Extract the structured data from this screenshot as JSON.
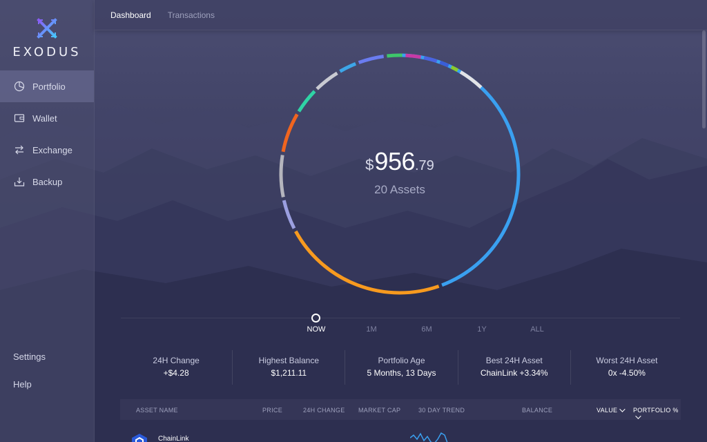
{
  "app": {
    "logo_text": "EXODUS",
    "brand_colors": {
      "primary": "#6b3cf0",
      "secondary": "#4aa7ff"
    }
  },
  "sidebar": {
    "items": [
      {
        "label": "Portfolio",
        "icon": "pie-chart-icon",
        "active": true
      },
      {
        "label": "Wallet",
        "icon": "wallet-icon",
        "active": false
      },
      {
        "label": "Exchange",
        "icon": "exchange-arrows-icon",
        "active": false
      },
      {
        "label": "Backup",
        "icon": "backup-tray-icon",
        "active": false
      }
    ],
    "bottom_links": [
      {
        "label": "Settings"
      },
      {
        "label": "Help"
      }
    ]
  },
  "tabs": [
    {
      "label": "Dashboard",
      "active": true
    },
    {
      "label": "Transactions",
      "active": false
    }
  ],
  "portfolio": {
    "currency_symbol": "$",
    "balance_int": "956",
    "balance_dec": ".79",
    "assets_label": "20 Assets",
    "allocation_colors": [
      "#3aa0f0",
      "#f79a1f",
      "#9b9fe0",
      "#b5b5bd",
      "#f0651f",
      "#2fd3a5",
      "#c9cad2",
      "#3da6e8",
      "#6a7cf0",
      "#3ec66b",
      "#c73aa6",
      "#4a64e0",
      "#3a5ed8",
      "#8acb2a",
      "#e3e3e6"
    ]
  },
  "timeline": {
    "periods": [
      {
        "label": "NOW",
        "active": true
      },
      {
        "label": "1M",
        "active": false
      },
      {
        "label": "6M",
        "active": false
      },
      {
        "label": "1Y",
        "active": false
      },
      {
        "label": "ALL",
        "active": false
      }
    ]
  },
  "stats": [
    {
      "label": "24H Change",
      "value": "+$4.28"
    },
    {
      "label": "Highest Balance",
      "value": "$1,211.11"
    },
    {
      "label": "Portfolio Age",
      "value": "5 Months, 13 Days"
    },
    {
      "label": "Best 24H Asset",
      "value": "ChainLink +3.34%"
    },
    {
      "label": "Worst 24H Asset",
      "value": "0x -4.50%"
    }
  ],
  "table": {
    "headers": {
      "asset_name": "ASSET NAME",
      "price": "PRICE",
      "change_24h": "24H CHANGE",
      "market_cap": "MARKET CAP",
      "trend_30d": "30 DAY TREND",
      "balance": "BALANCE",
      "value": "VALUE",
      "portfolio_pct": "PORTFOLIO %"
    },
    "rows": [
      {
        "name": "ChainLink",
        "icon": "chainlink-hexagon-icon",
        "icon_color": "#2a5ada"
      }
    ]
  }
}
